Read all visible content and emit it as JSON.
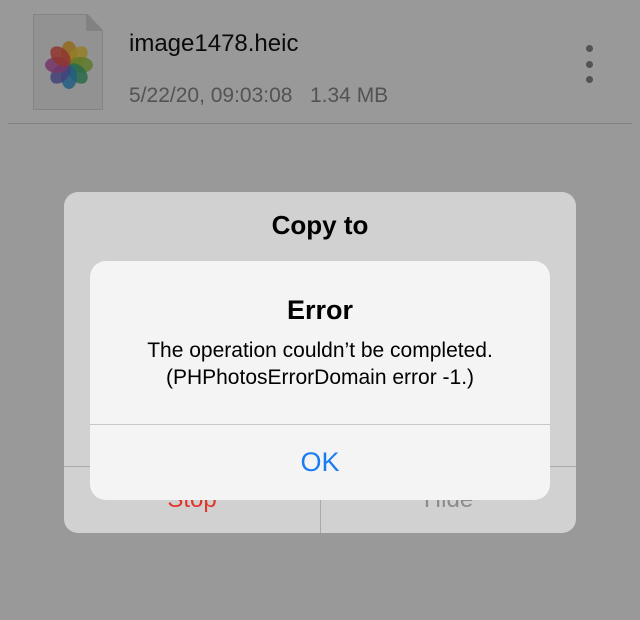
{
  "file": {
    "name": "image1478.heic",
    "meta": "5/22/20, 09:03:08   1.34 MB",
    "thumbnail_icon": "photos-app-icon"
  },
  "copy_dialog": {
    "title": "Copy to",
    "stop_label": "Stop",
    "hide_label": "Hide"
  },
  "error_alert": {
    "title": "Error",
    "message_line1": "The operation couldn’t be completed.",
    "message_line2": "(PHPhotosErrorDomain error -1.)",
    "ok_label": "OK"
  },
  "colors": {
    "accent_blue": "#1a7cf2",
    "destructive_red": "#e0362c"
  }
}
